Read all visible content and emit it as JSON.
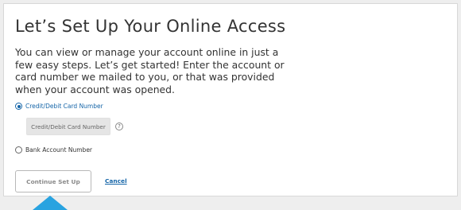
{
  "page": {
    "title": "Let’s Set Up Your Online Access",
    "description": "You can view or manage your account online in just a few easy steps. Let’s get started! Enter the account or card number we mailed to you, or that was provided when your account was opened."
  },
  "options": {
    "card": {
      "label": "Credit/Debit Card Number",
      "selected": true
    },
    "bank": {
      "label": "Bank Account Number",
      "selected": false
    }
  },
  "card_input": {
    "placeholder": "Credit/Debit Card Number",
    "value": ""
  },
  "help": {
    "glyph": "?",
    "icon": "question-circle-icon"
  },
  "actions": {
    "continue_label": "Continue Set Up",
    "cancel_label": "Cancel"
  },
  "colors": {
    "accent": "#1565a8",
    "pointer": "#29a3e0",
    "disabled_text": "#8a8a8a"
  }
}
